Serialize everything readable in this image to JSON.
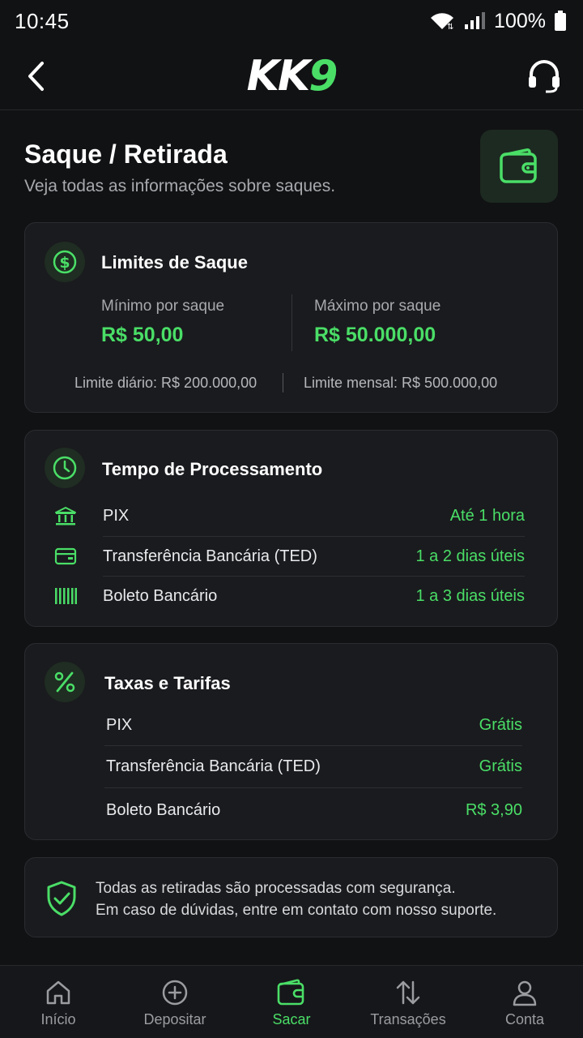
{
  "status_bar": {
    "time": "10:45",
    "battery": "100%"
  },
  "header": {
    "logo_main": "KK",
    "logo_accent": "9"
  },
  "page": {
    "title": "Saque / Retirada",
    "subtitle": "Veja todas as informações sobre saques."
  },
  "limits": {
    "title": "Limites de Saque",
    "min_label": "Mínimo por saque",
    "min_value": "R$ 50,00",
    "max_label": "Máximo por saque",
    "max_value": "R$ 50.000,00",
    "daily": "Limite diário: R$ 200.000,00",
    "monthly": "Limite mensal: R$ 500.000,00"
  },
  "processing": {
    "title": "Tempo de Processamento",
    "rows": [
      {
        "name": "PIX",
        "value": "Até 1 hora",
        "icon": "bank-icon"
      },
      {
        "name": "Transferência Bancária (TED)",
        "value": "1 a 2 dias úteis",
        "icon": "card-icon"
      },
      {
        "name": "Boleto Bancário",
        "value": "1 a 3 dias úteis",
        "icon": "barcode-icon"
      }
    ]
  },
  "fees": {
    "title": "Taxas e Tarifas",
    "rows": [
      {
        "name": "PIX",
        "value": "Grátis"
      },
      {
        "name": "Transferência Bancária (TED)",
        "value": "Grátis"
      },
      {
        "name": "Boleto Bancário",
        "value": "R$ 3,90"
      }
    ]
  },
  "security": {
    "line1": "Todas as retiradas são processadas com segurança.",
    "line2": "Em caso de dúvidas, entre em contato com nosso suporte."
  },
  "nav": [
    {
      "label": "Início",
      "icon": "home-icon",
      "active": false
    },
    {
      "label": "Depositar",
      "icon": "plus-circle-icon",
      "active": false
    },
    {
      "label": "Sacar",
      "icon": "wallet-icon",
      "active": true
    },
    {
      "label": "Transações",
      "icon": "transfer-icon",
      "active": false
    },
    {
      "label": "Conta",
      "icon": "user-icon",
      "active": false
    }
  ],
  "colors": {
    "accent": "#4ade67",
    "background": "#111214",
    "card": "#1a1b1e"
  }
}
